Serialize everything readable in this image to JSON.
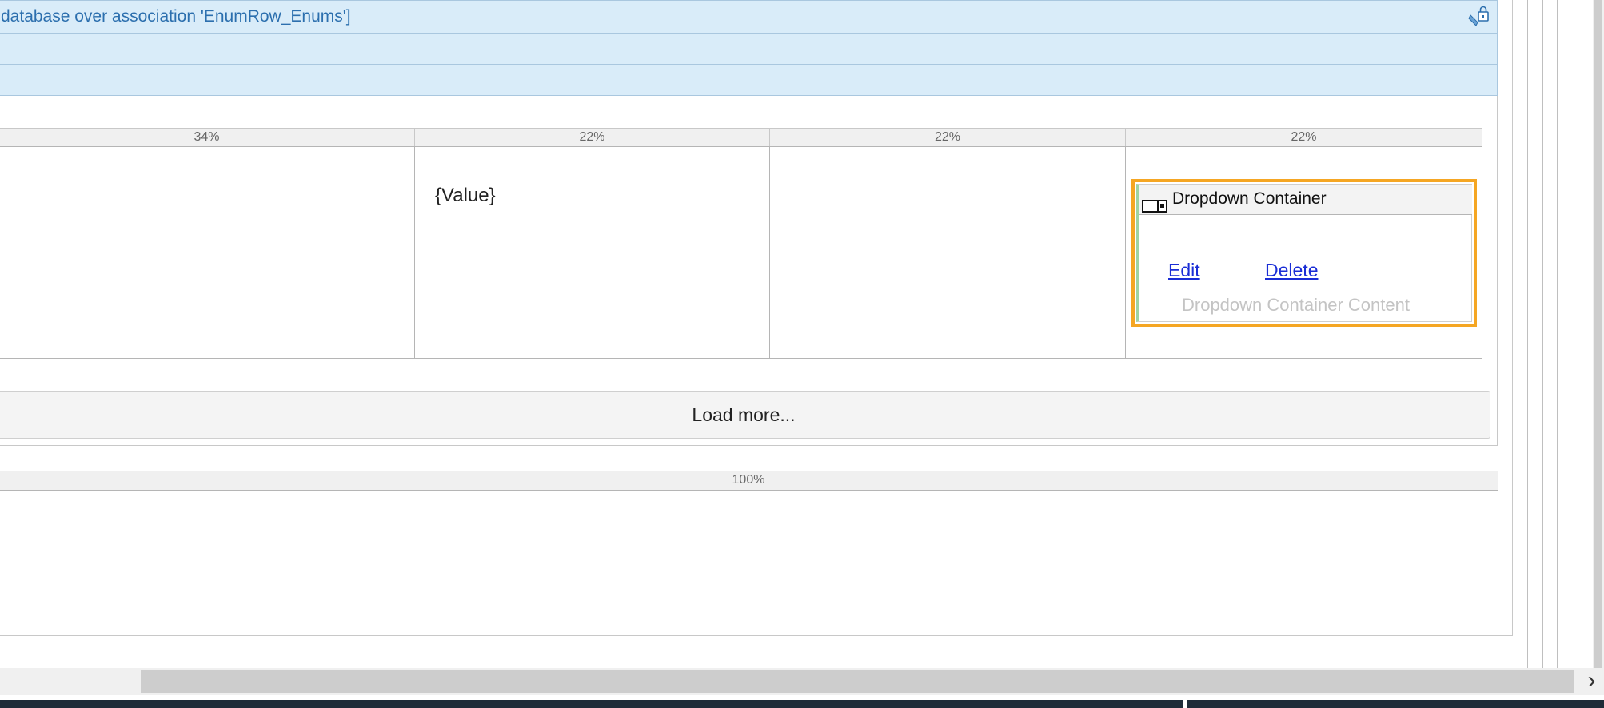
{
  "list_view": {
    "header_text": "database over association 'EnumRow_Enums']",
    "lock_icon": "lock-icon"
  },
  "layout_grid": {
    "columns": [
      {
        "width_label": "34%"
      },
      {
        "width_label": "22%"
      },
      {
        "width_label": "22%"
      },
      {
        "width_label": "22%"
      }
    ],
    "value_placeholder": "{Value}"
  },
  "dropdown_container": {
    "title": "Dropdown Container",
    "icon": "dropdown-container-icon",
    "edit_label": "Edit",
    "delete_label": "Delete",
    "content_placeholder": "Dropdown Container Content"
  },
  "load_more": {
    "label": "Load more..."
  },
  "lower_grid": {
    "width_label": "100%"
  },
  "scrollbar": {
    "right_arrow": "›"
  },
  "colors": {
    "header_bg": "#d9ecf9",
    "selection_outline": "#f5a623",
    "link": "#1a2dd6",
    "taskbar": "#1f2b38"
  }
}
